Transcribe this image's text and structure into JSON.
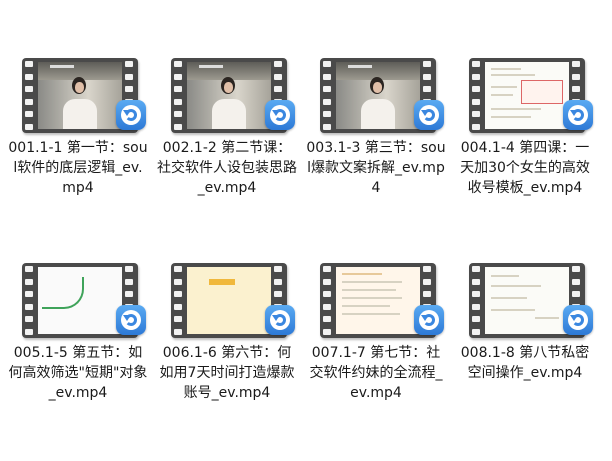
{
  "files": [
    {
      "name": "001.1-1 第一节：soul软件的底层逻辑_ev.mp4",
      "thumb": "video"
    },
    {
      "name": "002.1-2 第二节课：社交软件人设包装思路_ev.mp4",
      "thumb": "video"
    },
    {
      "name": "003.1-3 第三节：soul爆款文案拆解_ev.mp4",
      "thumb": "video"
    },
    {
      "name": "004.1-4 第四课：一天加30个女生的高效收号模板_ev.mp4",
      "thumb": "doc"
    },
    {
      "name": "005.1-5 第五节：如何高效筛选\"短期\"对象_ev.mp4",
      "thumb": "mind"
    },
    {
      "name": "006.1-6 第六节：何如用7天时间打造爆款账号_ev.mp4",
      "thumb": "yellow"
    },
    {
      "name": "007.1-7 第七节：社交软件约妹的全流程_ev.mp4",
      "thumb": "doc"
    },
    {
      "name": "008.1-8 第八节私密空间操作_ev.mp4",
      "thumb": "doc"
    }
  ],
  "colors": {
    "badge": "#3a87e0",
    "film": "#4a4a4a",
    "text": "#1a1a1a"
  },
  "icons": {
    "file": "video-file-icon",
    "badge": "player-app-icon"
  }
}
